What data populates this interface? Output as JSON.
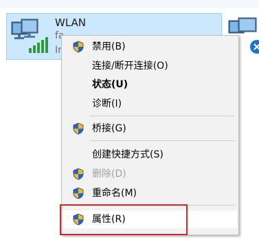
{
  "adapter": {
    "name": "WLAN",
    "line2": "fa",
    "line3": "In"
  },
  "context_menu": {
    "items": [
      {
        "label": "禁用(B)",
        "icon": "uac-shield-icon"
      },
      {
        "label": "连接/断开连接(O)"
      },
      {
        "label": "状态(U)",
        "bold": true
      },
      {
        "label": "诊断(I)"
      },
      {
        "label": "桥接(G)",
        "icon": "uac-shield-icon"
      },
      {
        "label": "创建快捷方式(S)"
      },
      {
        "label": "删除(D)",
        "icon": "uac-shield-icon",
        "disabled": true
      },
      {
        "label": "重命名(M)",
        "icon": "uac-shield-icon"
      },
      {
        "label": "属性(R)",
        "icon": "uac-shield-icon",
        "highlighted": true
      }
    ]
  },
  "colors": {
    "selection_fill": "#cce8ff",
    "selection_border": "#99d1ff",
    "menu_background": "#f2f2f2",
    "callout_border": "#d9232b"
  }
}
